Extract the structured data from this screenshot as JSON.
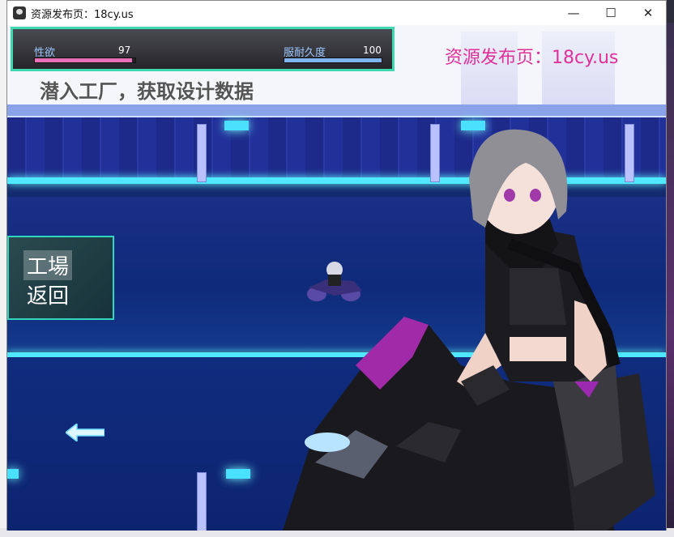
{
  "window": {
    "title": "资源发布页：18cy.us",
    "minimize_label": "—",
    "maximize_label": "☐",
    "close_label": "✕"
  },
  "hud": {
    "stat1": {
      "label": "性欲",
      "value": "97",
      "percent": 97,
      "color": "#e96fb8"
    },
    "stat2": {
      "label": "服耐久度",
      "value": "100",
      "percent": 100,
      "color": "#7fb4ee"
    }
  },
  "watermark": "资源发布页：18cy.us",
  "quest_text": "潜入工厂，获取设计数据",
  "menu": {
    "item1": "工場",
    "item2": "返回"
  },
  "colors": {
    "accent": "#2fd6c0",
    "watermark": "#e0309a",
    "neon": "#4fe8ff"
  },
  "icons": {
    "back_arrow": "left-arrow-icon"
  }
}
